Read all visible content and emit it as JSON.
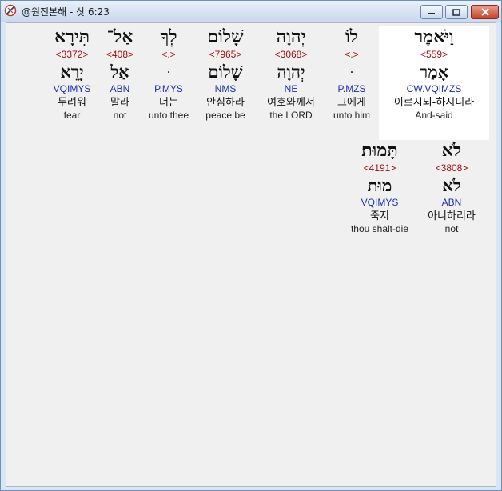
{
  "window": {
    "title": "@원전본해 - 삿 6:23"
  },
  "line1": [
    {
      "hebrew": "וַיֹּאמֶר",
      "strong": "<559>",
      "lemma": "אָמַר",
      "morph": "CW.VQIMZS",
      "korean": "이르시되-하시니라",
      "english": "And-said",
      "selected": true
    },
    {
      "hebrew": "לוֹ",
      "strong": "<.>",
      "lemma": "ּ",
      "morph": "P.MZS",
      "korean": "그에게",
      "english": "unto him",
      "selected": false
    },
    {
      "hebrew": "יְהוָה",
      "strong": "<3068>",
      "lemma": "יְהוָה",
      "morph": "NE",
      "korean": "여호와께서",
      "english": "the LORD",
      "selected": false
    },
    {
      "hebrew": "שָׁלוֹם",
      "strong": "<7965>",
      "lemma": "שָׁלוֹם",
      "morph": "NMS",
      "korean": "안심하라",
      "english": "peace be",
      "selected": false
    },
    {
      "hebrew": "לְךָ",
      "strong": "<.>",
      "lemma": "ּ",
      "morph": "P.MYS",
      "korean": "너는",
      "english": "unto thee",
      "selected": false
    },
    {
      "hebrew": "אַל־",
      "strong": "<408>",
      "lemma": "אַל",
      "morph": "ABN",
      "korean": "말라",
      "english": "not",
      "selected": false
    },
    {
      "hebrew": "תִּירָא",
      "strong": "<3372>",
      "lemma": "יָרֵא",
      "morph": "VQIMYS",
      "korean": "두려워",
      "english": "fear",
      "selected": false
    }
  ],
  "line2": [
    {
      "hebrew": "לֹא",
      "strong": "<3808>",
      "lemma": "לֹא",
      "morph": "ABN",
      "korean": "아니하리라",
      "english": "not",
      "selected": false
    },
    {
      "hebrew": "תָּמוּת׃",
      "strong": "<4191>",
      "lemma": "מוּת",
      "morph": "VQIMYS",
      "korean": "죽지",
      "english": "thou shalt-die",
      "selected": false
    }
  ]
}
